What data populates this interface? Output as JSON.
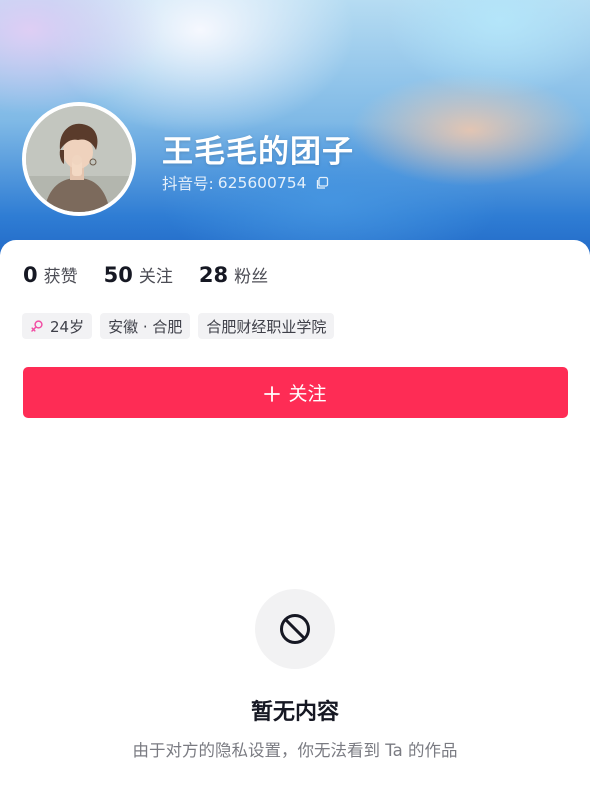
{
  "profile": {
    "name": "王毛毛的团子",
    "douyin_id_label": "抖音号: ",
    "douyin_id": "625600754"
  },
  "stats": [
    {
      "value": "0",
      "label": "获赞"
    },
    {
      "value": "50",
      "label": "关注"
    },
    {
      "value": "28",
      "label": "粉丝"
    }
  ],
  "tags": {
    "age": "24岁",
    "location": "安徽 · 合肥",
    "school": "合肥财经职业学院"
  },
  "follow_button": {
    "label": "关注"
  },
  "empty_state": {
    "title": "暂无内容",
    "message": "由于对方的隐私设置，你无法看到 Ta 的作品"
  },
  "colors": {
    "accent": "#fe2c55",
    "female_icon": "#f14fa4"
  }
}
